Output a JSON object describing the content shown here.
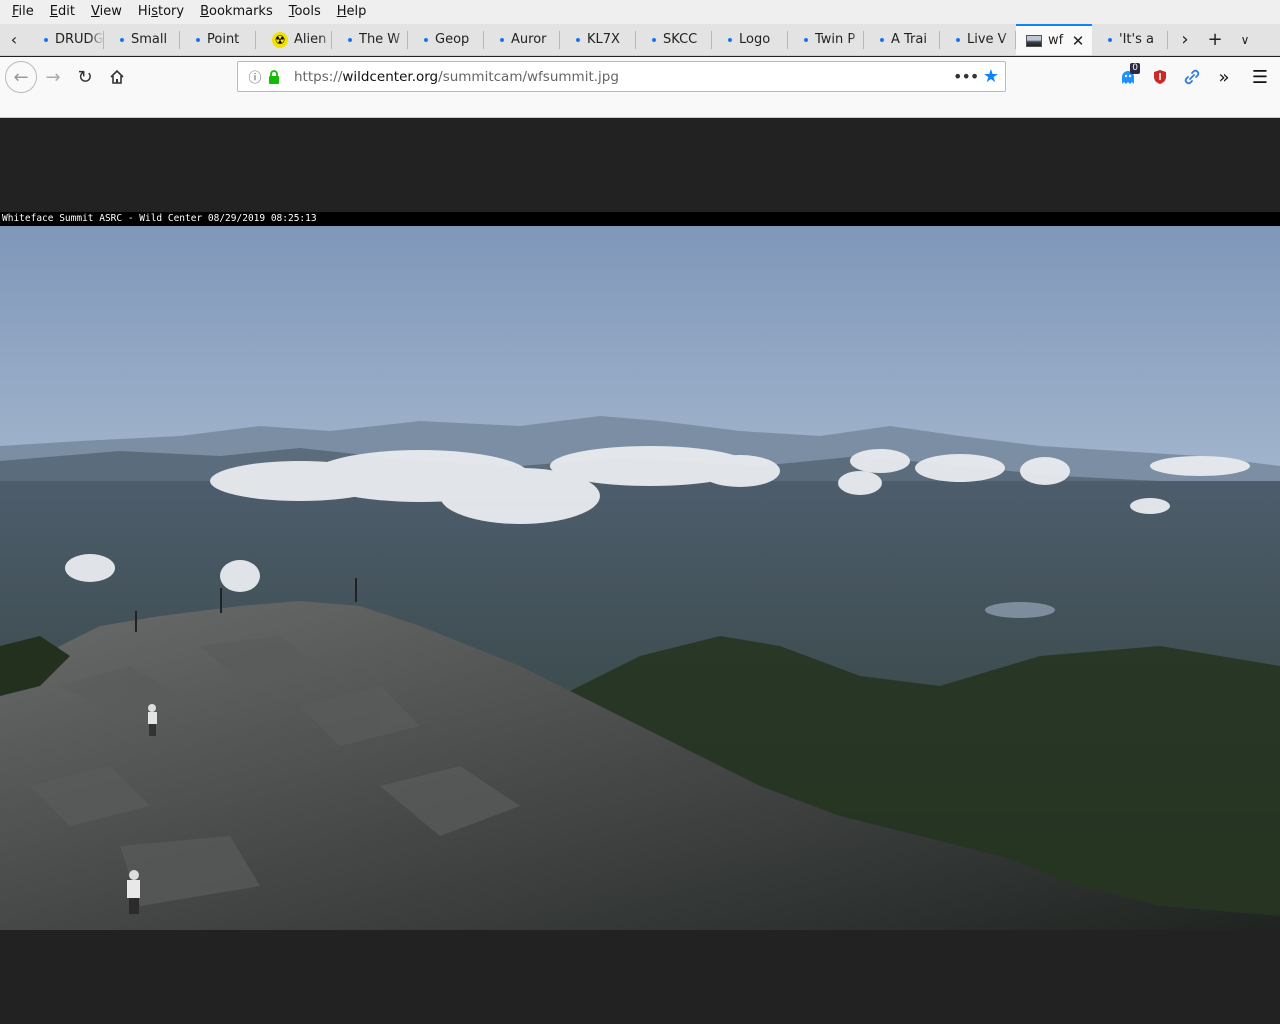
{
  "menu": [
    "File",
    "Edit",
    "View",
    "History",
    "Bookmarks",
    "Tools",
    "Help"
  ],
  "menu_accel": [
    "F",
    "E",
    "V",
    "s",
    "B",
    "T",
    "H"
  ],
  "tabs": [
    {
      "label": "DRUDGE"
    },
    {
      "label": "Small"
    },
    {
      "label": "Point"
    },
    {
      "label": "Alien",
      "icon": "radiation-icon"
    },
    {
      "label": "The W"
    },
    {
      "label": "Geop"
    },
    {
      "label": "Auror"
    },
    {
      "label": "KL7X"
    },
    {
      "label": "SKCC"
    },
    {
      "label": "Logo"
    },
    {
      "label": "Twin P"
    },
    {
      "label": "A Trai"
    },
    {
      "label": "Live V"
    },
    {
      "label": "wf",
      "active": true,
      "icon": "image-thumbnail-icon"
    },
    {
      "label": "'It's a"
    }
  ],
  "url": {
    "prefix": "https://",
    "host": "wildcenter.org",
    "path": "/summitcam/wfsummit.jpg"
  },
  "extension_badge": "0",
  "webcam": {
    "caption": "Whiteface Summit ASRC - Wild Center 08/29/2019 08:25:13"
  },
  "colors": {
    "accent": "#0a84ff",
    "lock": "#12bc00",
    "content_bg": "#222222"
  }
}
